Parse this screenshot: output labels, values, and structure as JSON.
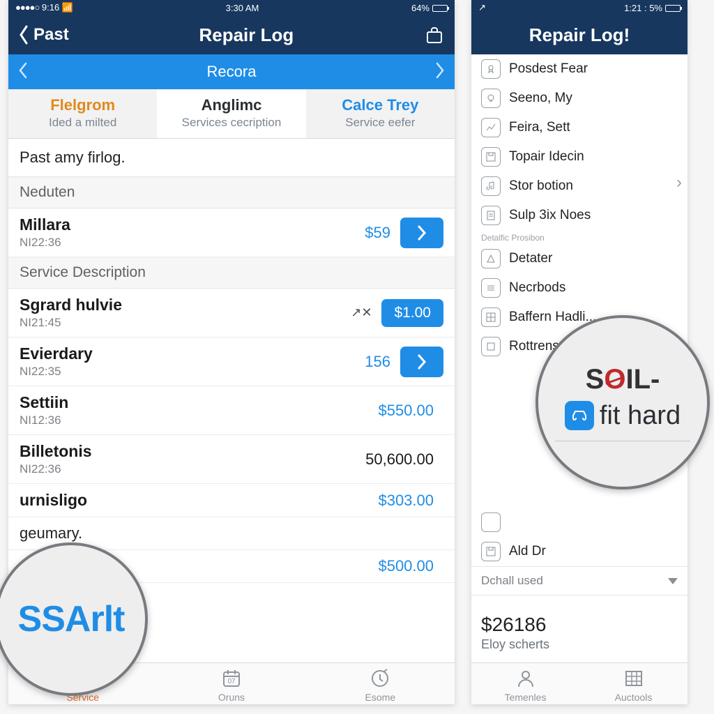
{
  "colors": {
    "navy": "#17375f",
    "blue": "#1f8de6",
    "orange": "#e08a1e",
    "accent_orange": "#e06a2a"
  },
  "left": {
    "status": {
      "signal": "●●●●○",
      "time_left": "9:16",
      "wifi": "wifi-icon",
      "center_time": "3:30 AM",
      "battery_pct": "64%"
    },
    "nav": {
      "back_label": "Past",
      "title": "Repair Log"
    },
    "subbar": {
      "label": "Recora"
    },
    "tabs": [
      {
        "title": "Flelgrom",
        "subtitle": "Ided a milted",
        "style": "orange"
      },
      {
        "title": "Anglimc",
        "subtitle": "Services cecription",
        "style": "dark",
        "active": true
      },
      {
        "title": "Calce Trey",
        "subtitle": "Service eefer",
        "style": "blue"
      }
    ],
    "list_title": "Past amy firlog.",
    "sections": [
      {
        "header": "Neduten",
        "rows": [
          {
            "name": "Millara",
            "meta": "NI22:36",
            "price": "$59",
            "price_style": "blue",
            "chev": true
          }
        ]
      },
      {
        "header": "Service Description",
        "rows": [
          {
            "name": "Sgrard hulvie",
            "meta": "NI21:45",
            "tiny_icon": "↗✕",
            "price_btn": "$1.00"
          },
          {
            "name": "Evierdary",
            "meta": "NI22:35",
            "price": "156",
            "price_style": "blue",
            "chev": true
          },
          {
            "name": "Settiin",
            "meta": "NI12:36",
            "price": "$550.00",
            "price_style": "blue"
          },
          {
            "name": "Billetonis",
            "meta": "NI22:36",
            "price": "50,600.00",
            "price_style": "black"
          },
          {
            "name": "urnisligo",
            "meta": "",
            "price": "$303.00",
            "price_style": "blue"
          },
          {
            "solo_text": "geumary."
          },
          {
            "name": "",
            "meta": "",
            "price": "$500.00",
            "price_style": "blue"
          }
        ]
      }
    ],
    "tabbar": [
      {
        "label": "Service",
        "icon": "plus-medical-icon",
        "active": true
      },
      {
        "label": "Oruns",
        "icon": "calendar-icon"
      },
      {
        "label": "Esome",
        "icon": "clock-check-icon"
      }
    ],
    "mag_text": "SSArlt"
  },
  "right": {
    "status": {
      "right_text": "1:21 : 5%"
    },
    "nav": {
      "title": "Repair Log!"
    },
    "group1": [
      {
        "icon": "badge-icon",
        "label": "Posdest Fear"
      },
      {
        "icon": "bulb-icon",
        "label": "Seeno, My"
      },
      {
        "icon": "chart-icon",
        "label": "Feira, Sett"
      },
      {
        "icon": "save-icon",
        "label": "Topair Idecin"
      },
      {
        "icon": "music-icon",
        "label": "Stor botion"
      },
      {
        "icon": "doc-icon",
        "label": "Sulp 3ix Noes"
      }
    ],
    "sep1": "Detalfic Prosibon",
    "group2": [
      {
        "icon": "triangle-icon",
        "label": "Detater"
      },
      {
        "icon": "lines-icon",
        "label": "Necrbods"
      },
      {
        "icon": "grid-icon",
        "label": "Baffern Hadli..."
      },
      {
        "icon": "square-icon",
        "label": "Rottrensasine"
      }
    ],
    "group3": [
      {
        "icon": "square-icon",
        "label": ""
      },
      {
        "icon": "save-icon",
        "label": "Ald Dr"
      }
    ],
    "dropdown": "Dchall used",
    "summary": {
      "amount": "$26186",
      "label": "Eloy scherts"
    },
    "tabbar": [
      {
        "label": "Temenles",
        "icon": "person-icon"
      },
      {
        "label": "Auctools",
        "icon": "table-icon"
      }
    ],
    "mag": {
      "line1a": "S",
      "line1x": "O",
      "line1b": "IL-",
      "line2": "fit hard"
    }
  }
}
